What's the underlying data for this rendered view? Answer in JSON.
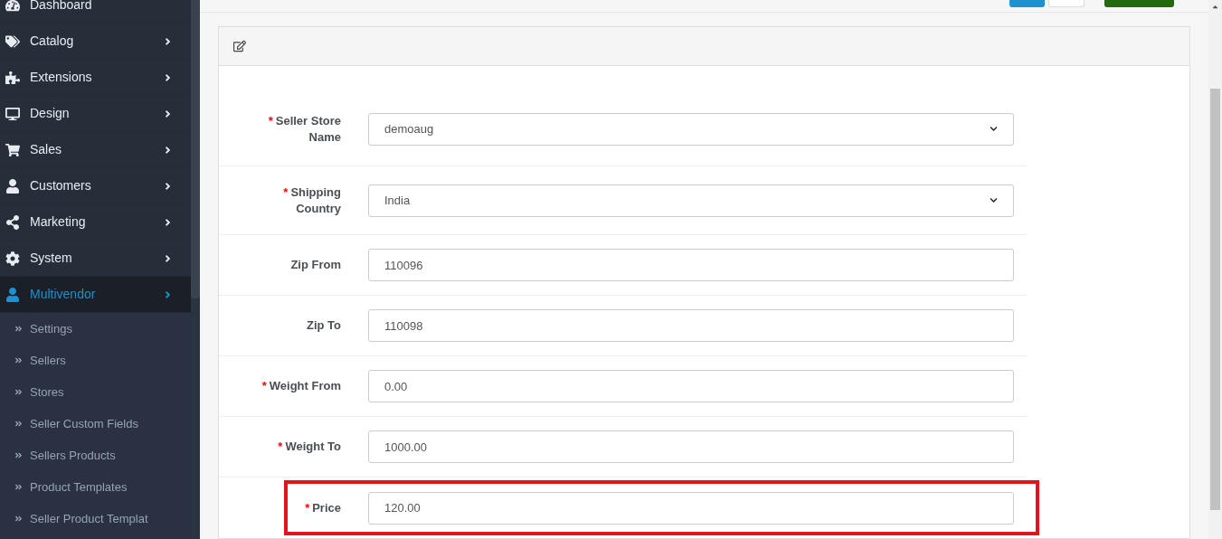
{
  "sidebar": {
    "items": [
      {
        "label": "Dashboard",
        "selected": false,
        "arrow": false
      },
      {
        "label": "Catalog",
        "selected": false,
        "arrow": true
      },
      {
        "label": "Extensions",
        "selected": false,
        "arrow": true
      },
      {
        "label": "Design",
        "selected": false,
        "arrow": true
      },
      {
        "label": "Sales",
        "selected": false,
        "arrow": true
      },
      {
        "label": "Customers",
        "selected": false,
        "arrow": true
      },
      {
        "label": "Marketing",
        "selected": false,
        "arrow": true
      },
      {
        "label": "System",
        "selected": false,
        "arrow": true
      },
      {
        "label": "Multivendor",
        "selected": true,
        "arrow": true
      }
    ],
    "subitems": [
      "Settings",
      "Sellers",
      "Stores",
      "Seller Custom Fields",
      "Sellers Products",
      "Product Templates",
      "Seller Product Templat"
    ]
  },
  "form": {
    "fields": [
      {
        "label": "Seller Store Name",
        "required_mark": "*",
        "kind": "select",
        "value": "demoaug",
        "highlighted": false
      },
      {
        "label": "Shipping Country",
        "required_mark": "*",
        "kind": "select",
        "value": "India",
        "highlighted": false
      },
      {
        "label": "Zip From",
        "kind": "input",
        "value": "110096",
        "highlighted": false
      },
      {
        "label": "Zip To",
        "kind": "input",
        "value": "110098",
        "highlighted": false
      },
      {
        "label": "Weight From",
        "required_mark": "*",
        "kind": "input",
        "value": "0.00",
        "highlighted": false
      },
      {
        "label": "Weight To",
        "required_mark": "*",
        "kind": "input",
        "value": "1000.00",
        "highlighted": false
      },
      {
        "label": "Price",
        "required_mark": "*",
        "kind": "input",
        "value": "120.00",
        "highlighted": true
      }
    ]
  }
}
